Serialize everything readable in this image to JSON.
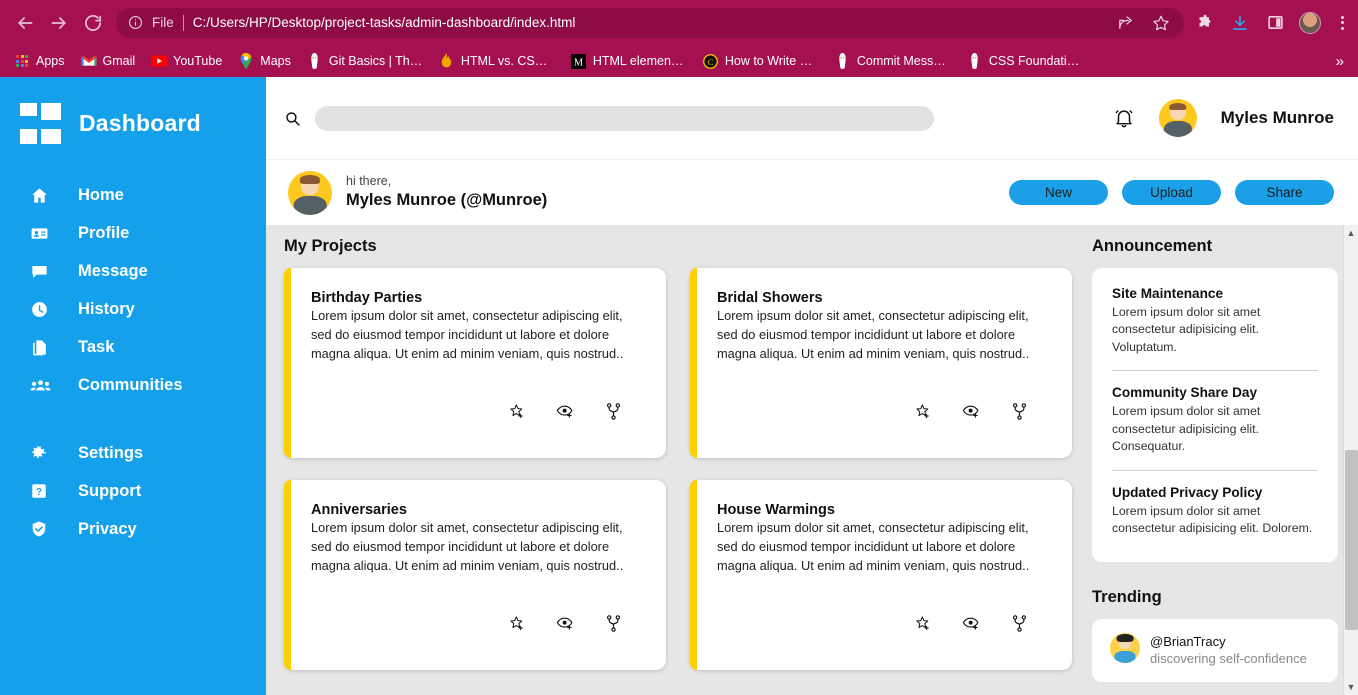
{
  "browser": {
    "nav": {
      "back": "back-arrow",
      "forward": "forward-arrow",
      "reload": "reload"
    },
    "omnibox": {
      "info_icon": "info-circle-icon",
      "scheme_label": "File",
      "url": "C:/Users/HP/Desktop/project-tasks/admin-dashboard/index.html"
    },
    "toolbar_icons": [
      "share-icon",
      "bookmark-star-icon",
      "extensions-puzzle-icon",
      "downloads-icon",
      "side-panel-icon",
      "profile-avatar-icon",
      "chrome-menu-icon"
    ],
    "chrome_color": "#a51050",
    "bookmarks": [
      {
        "label": "Apps",
        "icon": "apps-grid-icon"
      },
      {
        "label": "Gmail",
        "icon": "gmail-icon"
      },
      {
        "label": "YouTube",
        "icon": "youtube-icon"
      },
      {
        "label": "Maps",
        "icon": "maps-pin-icon"
      },
      {
        "label": "Git Basics | The Odi...",
        "icon": "odin-project-icon"
      },
      {
        "label": "HTML vs. CSS vs. Ja...",
        "icon": "flame-icon"
      },
      {
        "label": "HTML elements ref...",
        "icon": "mdn-icon"
      },
      {
        "label": "How to Write a Git...",
        "icon": "chris-beams-icon"
      },
      {
        "label": "Commit Messages |...",
        "icon": "odin-project-icon"
      },
      {
        "label": "CSS Foundations | T...",
        "icon": "odin-project-icon"
      }
    ],
    "bookmarks_overflow": "»"
  },
  "sidebar": {
    "brand": "Dashboard",
    "brand_logo": "dashboard-grid-logo",
    "accent": "#14a0ea",
    "items": [
      {
        "label": "Home",
        "icon": "home-icon"
      },
      {
        "label": "Profile",
        "icon": "id-card-icon"
      },
      {
        "label": "Message",
        "icon": "chat-bubble-icon"
      },
      {
        "label": "History",
        "icon": "clock-icon"
      },
      {
        "label": "Task",
        "icon": "file-copy-icon"
      },
      {
        "label": "Communities",
        "icon": "people-group-icon"
      }
    ],
    "items_secondary": [
      {
        "label": "Settings",
        "icon": "gear-icon"
      },
      {
        "label": "Support",
        "icon": "question-box-icon"
      },
      {
        "label": "Privacy",
        "icon": "shield-check-icon"
      }
    ]
  },
  "topbar": {
    "search_icon": "search-icon",
    "search_value": "",
    "search_placeholder": "",
    "bell_icon": "notification-bell-icon",
    "avatar": "user-avatar",
    "username": "Myles Munroe"
  },
  "greeting": {
    "avatar": "user-avatar",
    "hi": "hi there,",
    "name": "Myles Munroe (@Munroe)",
    "buttons": [
      {
        "label": "New",
        "name": "new-button"
      },
      {
        "label": "Upload",
        "name": "upload-button"
      },
      {
        "label": "Share",
        "name": "share-button"
      }
    ],
    "button_color": "#1ba0e8"
  },
  "projects": {
    "heading": "My Projects",
    "accent_bar_color": "#ffd000",
    "card_icons": [
      {
        "name": "star-add-icon",
        "label": "star"
      },
      {
        "name": "watch-eye-icon",
        "label": "watch"
      },
      {
        "name": "fork-icon",
        "label": "fork"
      }
    ],
    "cards": [
      {
        "title": "Birthday Parties",
        "desc": "Lorem ipsum dolor sit amet, consectetur adipiscing elit, sed do eiusmod tempor incididunt ut labore et dolore magna aliqua. Ut enim ad minim veniam, quis nostrud.."
      },
      {
        "title": "Bridal Showers",
        "desc": "Lorem ipsum dolor sit amet, consectetur adipiscing elit, sed do eiusmod tempor incididunt ut labore et dolore magna aliqua. Ut enim ad minim veniam, quis nostrud.."
      },
      {
        "title": "Anniversaries",
        "desc": "Lorem ipsum dolor sit amet, consectetur adipiscing elit, sed do eiusmod tempor incididunt ut labore et dolore magna aliqua. Ut enim ad minim veniam, quis nostrud.."
      },
      {
        "title": "House Warmings",
        "desc": "Lorem ipsum dolor sit amet, consectetur adipiscing elit, sed do eiusmod tempor incididunt ut labore et dolore magna aliqua. Ut enim ad minim veniam, quis nostrud.."
      }
    ]
  },
  "announcement": {
    "heading": "Announcement",
    "items": [
      {
        "title": "Site Maintenance",
        "body": "Lorem ipsum dolor sit amet consectetur adipisicing elit. Voluptatum."
      },
      {
        "title": "Community Share Day",
        "body": "Lorem ipsum dolor sit amet consectetur adipisicing elit. Consequatur."
      },
      {
        "title": "Updated Privacy Policy",
        "body": "Lorem ipsum dolor sit amet consectetur adipisicing elit. Dolorem."
      }
    ]
  },
  "trending": {
    "heading": "Trending",
    "items": [
      {
        "handle": "@BrianTracy",
        "sub": "discovering self-confidence",
        "avatar": "trending-avatar"
      }
    ]
  }
}
